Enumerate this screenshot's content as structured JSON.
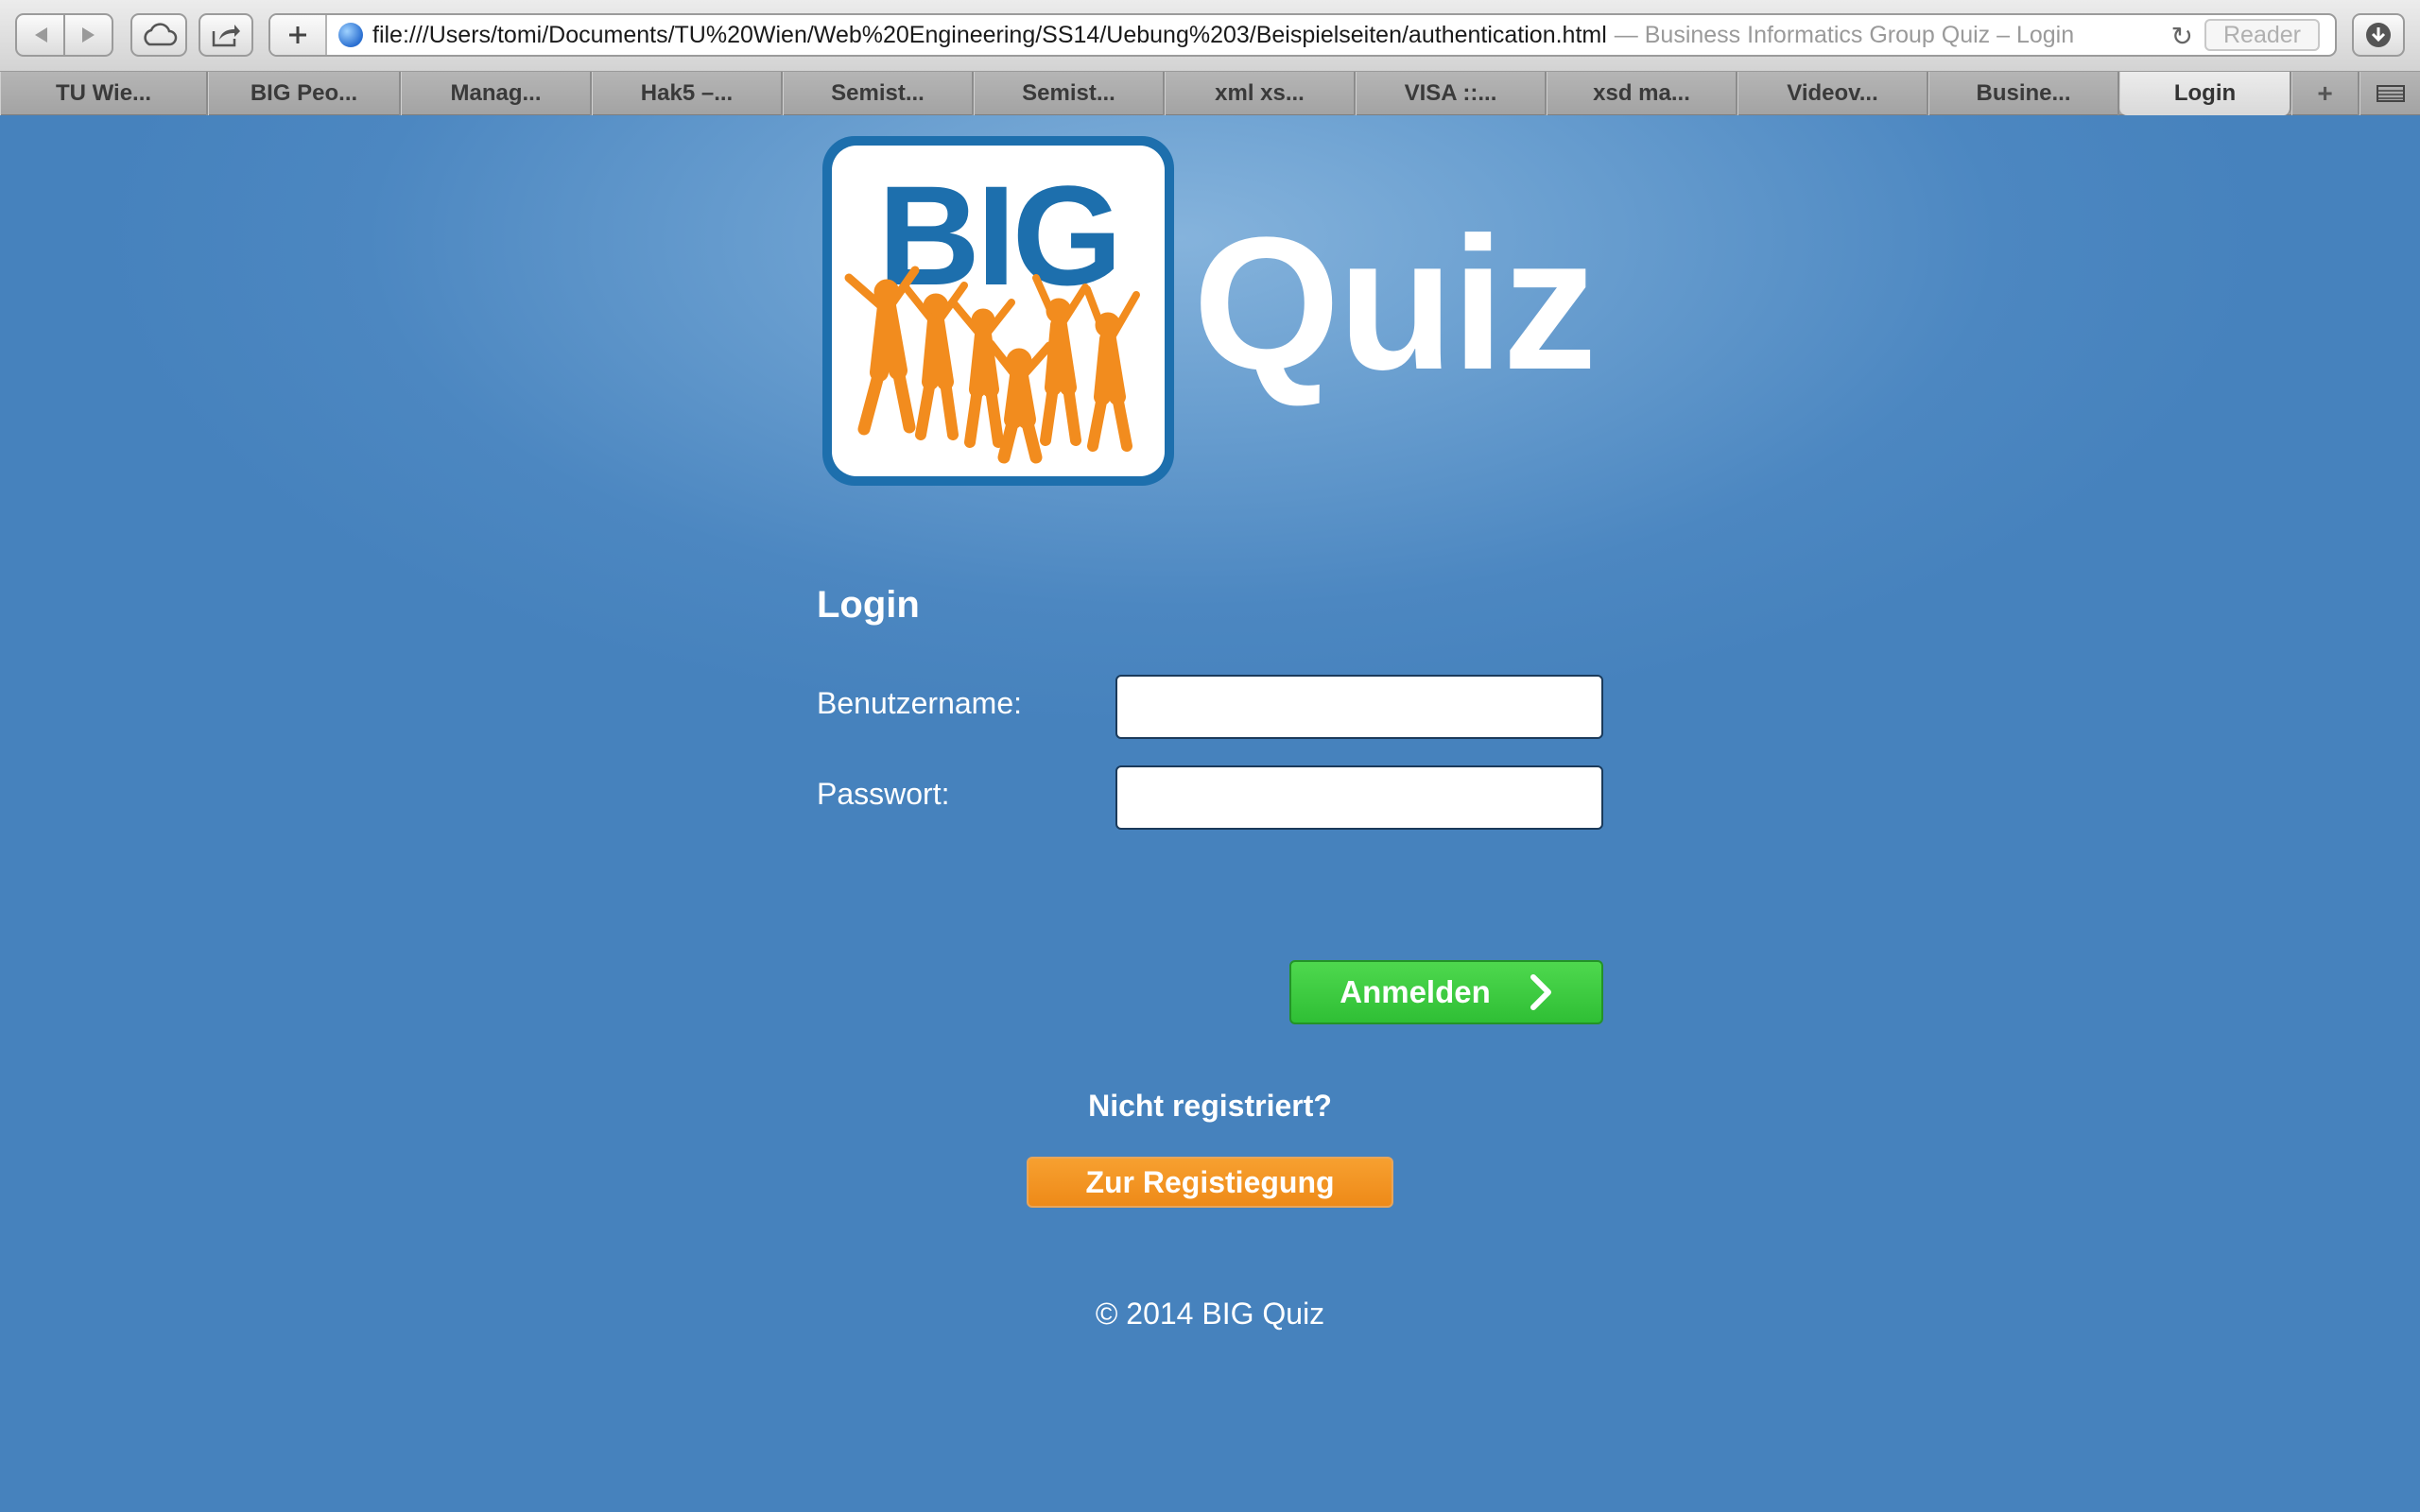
{
  "browser": {
    "url": "file:///Users/tomi/Documents/TU%20Wien/Web%20Engineering/SS14/Uebung%203/Beispielseiten/authentication.html",
    "page_title": "— Business Informatics Group Quiz – Login",
    "reader_label": "Reader",
    "tabs": [
      {
        "label": "TU Wie..."
      },
      {
        "label": "BIG Peo..."
      },
      {
        "label": "Manag..."
      },
      {
        "label": "Hak5 –..."
      },
      {
        "label": "Semist..."
      },
      {
        "label": "Semist..."
      },
      {
        "label": "xml xs..."
      },
      {
        "label": "VISA ::..."
      },
      {
        "label": "xsd ma..."
      },
      {
        "label": "Videov..."
      },
      {
        "label": "Busine..."
      },
      {
        "label": "Login"
      }
    ],
    "active_tab": 11
  },
  "logo": {
    "mark_text": "BIG",
    "title": "Quiz"
  },
  "login": {
    "heading": "Login",
    "username_label": "Benutzername:",
    "username_value": "",
    "password_label": "Passwort:",
    "password_value": "",
    "submit_label": "Anmelden"
  },
  "register": {
    "prompt": "Nicht registriert?",
    "button_label": "Zur Registiegung"
  },
  "footer": {
    "copyright": "© 2014 BIG Quiz"
  },
  "colors": {
    "page_background": "#4682bd",
    "logo_blue": "#1d6fad",
    "logo_orange": "#f28c1e",
    "login_button": "#3cc93e",
    "register_button": "#f0901e"
  }
}
